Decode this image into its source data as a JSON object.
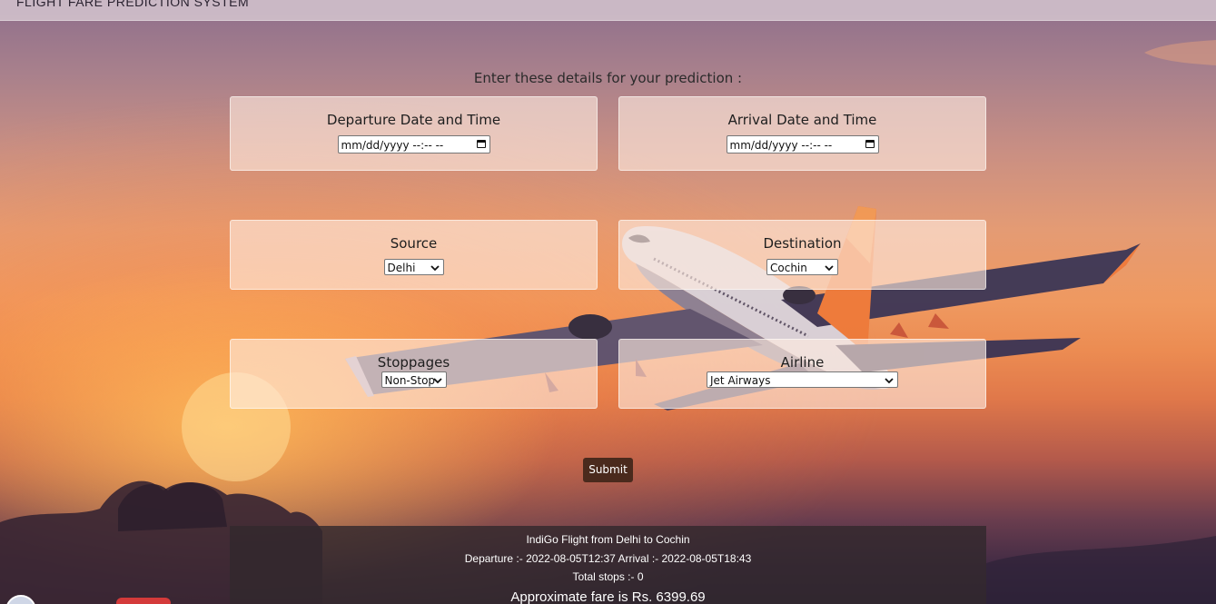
{
  "header": {
    "title": "FLIGHT FARE PREDICTION SYSTEM"
  },
  "form": {
    "prompt": "Enter these details for your prediction :",
    "departure": {
      "label": "Departure Date and Time",
      "placeholder": "mm/dd/yyyy --:-- --"
    },
    "arrival": {
      "label": "Arrival Date and Time",
      "placeholder": "mm/dd/yyyy --:-- --"
    },
    "source": {
      "label": "Source",
      "selected": "Delhi"
    },
    "destination": {
      "label": "Destination",
      "selected": "Cochin"
    },
    "stoppages": {
      "label": "Stoppages",
      "selected": "Non-Stop"
    },
    "airline": {
      "label": "Airline",
      "selected": "Jet Airways"
    },
    "submit_label": "Submit"
  },
  "result": {
    "flight": "IndiGo Flight from Delhi to Cochin",
    "times": "Departure :- 2022-08-05T12:37 Arrival :- 2022-08-05T18:43",
    "stops": "Total stops :- 0",
    "fare": "Approximate fare is Rs. 6399.69"
  },
  "colors": {
    "submit_bg": "#4a2a1d",
    "card_bg": "rgba(255,235,225,0.62)",
    "result_bg": "rgba(50,40,45,0.82)"
  }
}
